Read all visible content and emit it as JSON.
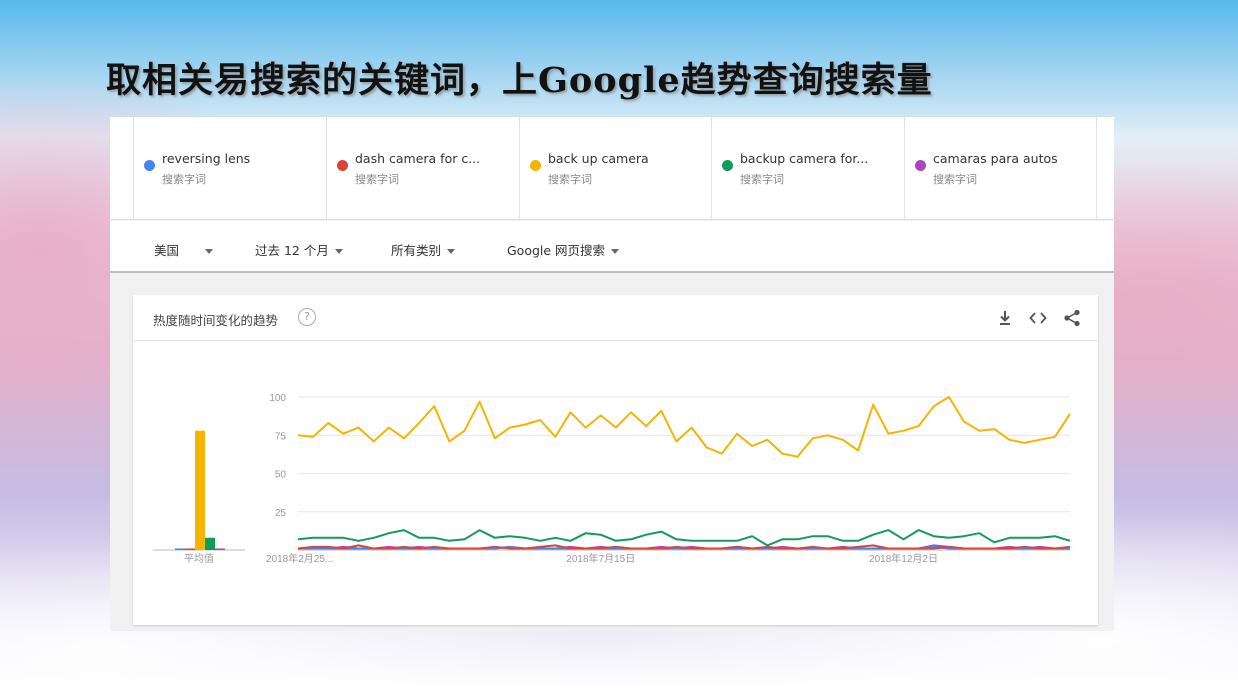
{
  "slide": {
    "title": "取相关易搜索的关键词，上Google趋势查询搜索量"
  },
  "terms": [
    {
      "name": "reversing lens",
      "sub": "搜索字词",
      "color": "#4285f4"
    },
    {
      "name": "dash camera for c...",
      "sub": "搜索字词",
      "color": "#db4437"
    },
    {
      "name": "back up camera",
      "sub": "搜索字词",
      "color": "#f4b400"
    },
    {
      "name": "backup camera for...",
      "sub": "搜索字词",
      "color": "#0f9d58"
    },
    {
      "name": "camaras para autos",
      "sub": "搜索字词",
      "color": "#ab47bc"
    }
  ],
  "filters": {
    "region": "美国",
    "time": "过去 12 个月",
    "category": "所有类别",
    "search_type": "Google 网页搜索"
  },
  "card": {
    "title": "热度随时间变化的趋势",
    "help": "?",
    "download_icon": "download-icon",
    "embed_icon": "embed-code-icon",
    "share_icon": "share-icon"
  },
  "chart_data": {
    "type": "line",
    "ylim": [
      0,
      100
    ],
    "yticks": [
      "100",
      "75",
      "50",
      "25"
    ],
    "xtick_labels": [
      "2018年2月25...",
      "2018年7月15日",
      "2018年12月2日"
    ],
    "average": {
      "label": "平均值",
      "values": [
        1,
        1,
        78,
        8,
        1
      ]
    },
    "series": [
      {
        "name": "back up camera",
        "color": "#f4b400",
        "values": [
          75,
          74,
          83,
          76,
          80,
          71,
          80,
          73,
          83,
          94,
          71,
          78,
          97,
          73,
          80,
          82,
          85,
          74,
          90,
          80,
          88,
          80,
          90,
          81,
          91,
          71,
          80,
          67,
          63,
          76,
          68,
          72,
          63,
          61,
          73,
          75,
          72,
          65,
          95,
          76,
          78,
          81,
          94,
          100,
          84,
          78,
          79,
          72,
          70,
          72,
          74,
          89
        ]
      },
      {
        "name": "backup camera for...",
        "color": "#0f9d58",
        "values": [
          7,
          8,
          8,
          8,
          6,
          8,
          11,
          13,
          8,
          8,
          6,
          7,
          13,
          8,
          9,
          8,
          6,
          8,
          6,
          11,
          10,
          6,
          7,
          10,
          12,
          7,
          6,
          6,
          6,
          6,
          9,
          3,
          7,
          7,
          9,
          9,
          6,
          6,
          10,
          13,
          7,
          13,
          9,
          8,
          9,
          11,
          5,
          8,
          8,
          8,
          9,
          6
        ]
      },
      {
        "name": "dash camera for c...",
        "color": "#db4437",
        "values": [
          1,
          2,
          2,
          1,
          3,
          1,
          1,
          2,
          1,
          2,
          1,
          1,
          1,
          2,
          1,
          1,
          2,
          3,
          1,
          1,
          1,
          2,
          1,
          1,
          1,
          2,
          1,
          1,
          1,
          2,
          1,
          2,
          1,
          1,
          2,
          1,
          1,
          2,
          3,
          1,
          1,
          1,
          1,
          2,
          1,
          1,
          1,
          1,
          2,
          1,
          1,
          2
        ]
      },
      {
        "name": "reversing lens",
        "color": "#4285f4",
        "values": [
          1,
          1,
          1,
          1,
          1,
          1,
          1,
          1,
          1,
          1,
          1,
          1,
          1,
          1,
          2,
          1,
          1,
          1,
          1,
          1,
          1,
          1,
          1,
          1,
          1,
          1,
          1,
          1,
          1,
          1,
          1,
          1,
          1,
          1,
          1,
          1,
          1,
          1,
          1,
          1,
          1,
          1,
          2,
          1,
          1,
          1,
          1,
          1,
          1,
          1,
          1,
          1
        ]
      },
      {
        "name": "camaras para autos",
        "color": "#ab47bc",
        "values": [
          1,
          1,
          1,
          2,
          1,
          1,
          2,
          1,
          2,
          1,
          1,
          1,
          1,
          1,
          2,
          1,
          1,
          1,
          2,
          1,
          2,
          1,
          1,
          1,
          2,
          1,
          2,
          1,
          1,
          2,
          1,
          1,
          2,
          1,
          1,
          1,
          2,
          1,
          1,
          1,
          1,
          1,
          3,
          2,
          1,
          1,
          1,
          2,
          1,
          2,
          1,
          1
        ]
      }
    ]
  }
}
